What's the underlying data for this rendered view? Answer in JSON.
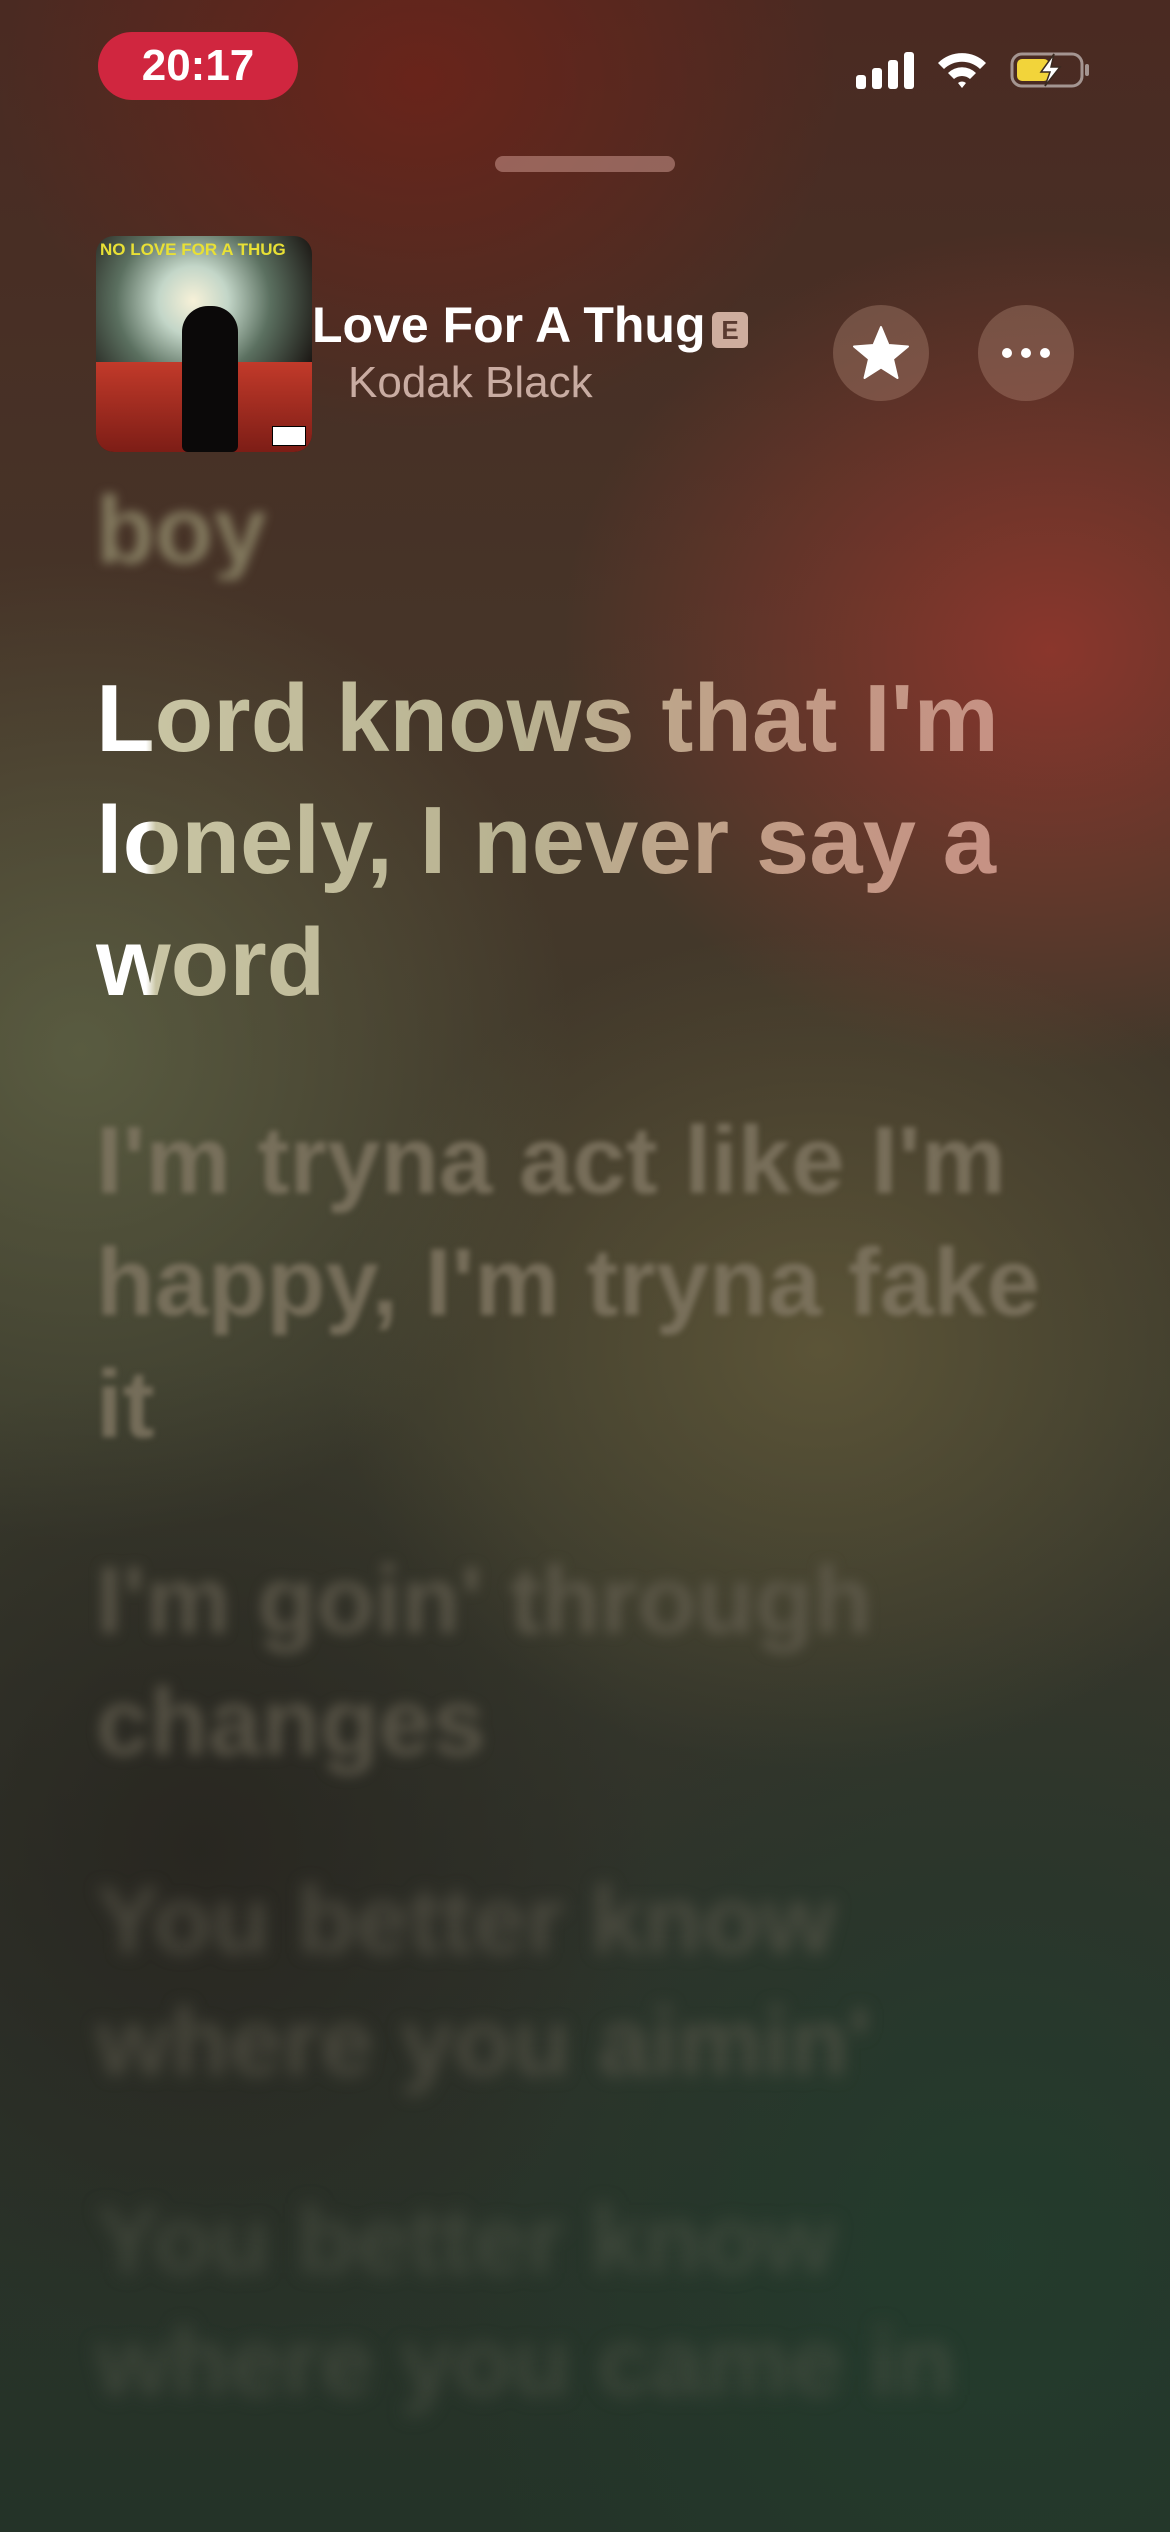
{
  "status_bar": {
    "time": "20:17",
    "time_pill_color": "#d0263f",
    "icons": [
      "cellular-signal-icon",
      "wifi-icon",
      "battery-charging-icon"
    ],
    "battery_color": "#f2d43a"
  },
  "now_playing": {
    "artwork_text": "NO LOVE FOR A THUG",
    "title": "Love For A Thug",
    "explicit_badge": "E",
    "artist": "Kodak Black",
    "favorite_icon": "star-icon",
    "more_icon": "ellipsis-icon"
  },
  "lyrics": {
    "previous": "boy",
    "current": "Lord knows that I'm lonely, I never say a word",
    "upcoming": [
      "I'm tryna act like I'm happy, I'm tryna fake it",
      "I'm goin' through changes",
      "You better know where you aimin'",
      "You better know where you came in"
    ]
  }
}
